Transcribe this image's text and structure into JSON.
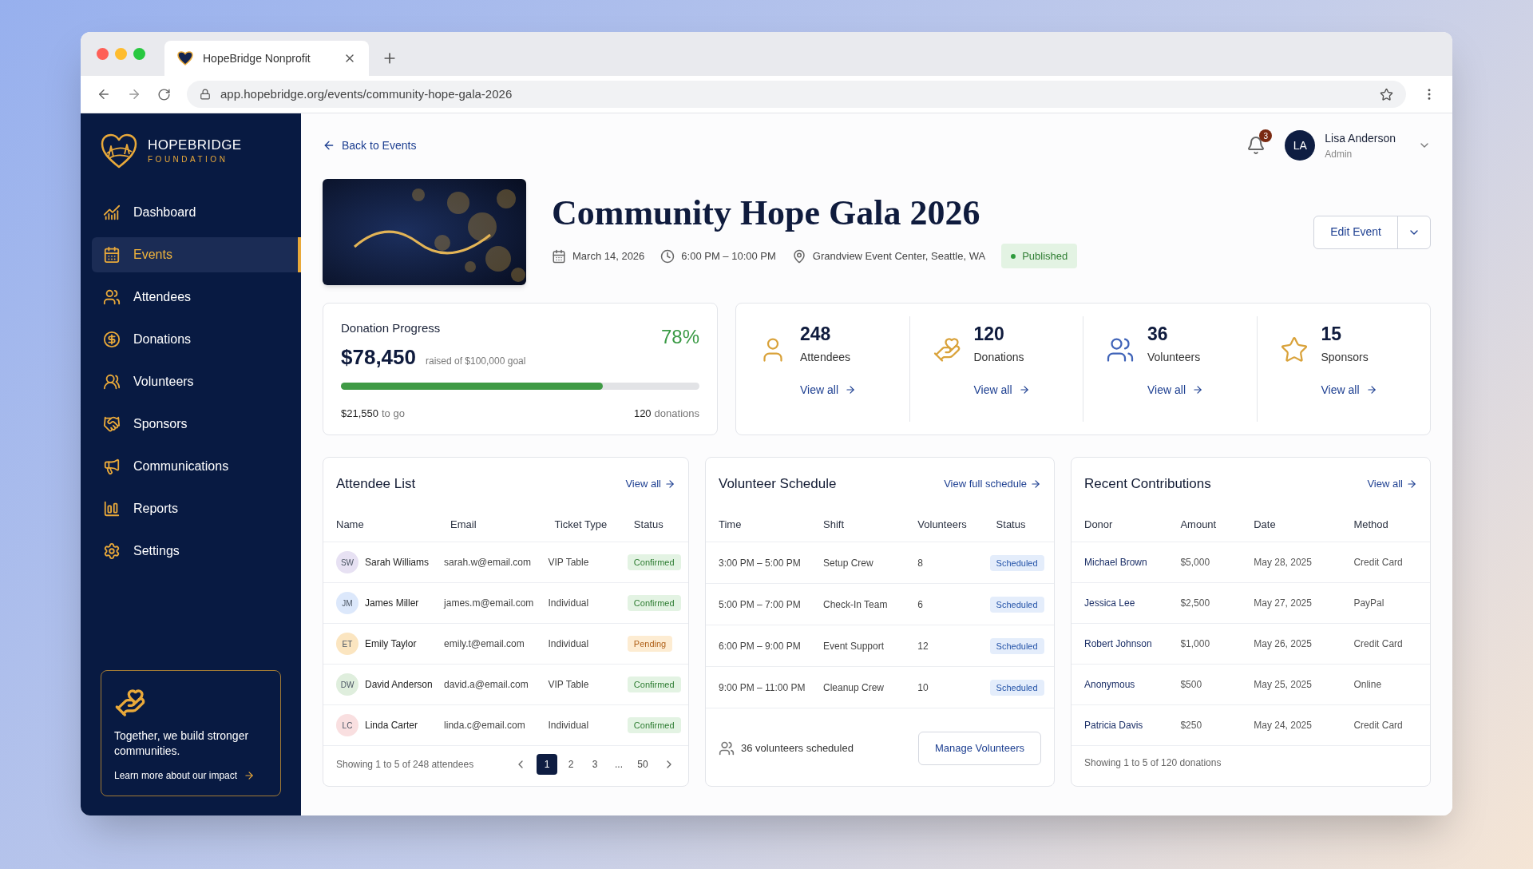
{
  "browser": {
    "tab_title": "HopeBridge Nonprofit",
    "url": "app.hopebridge.org/events/community-hope-gala-2026"
  },
  "sidebar": {
    "brand": {
      "name": "HOPEBRIDGE",
      "tagline": "FOUNDATION"
    },
    "items": [
      {
        "label": "Dashboard",
        "kind": "dashboard",
        "selected": false
      },
      {
        "label": "Events",
        "kind": "events",
        "selected": true
      },
      {
        "label": "Attendees",
        "kind": "attendees",
        "selected": false
      },
      {
        "label": "Donations",
        "kind": "donations",
        "selected": false
      },
      {
        "label": "Volunteers",
        "kind": "volunteers",
        "selected": false
      },
      {
        "label": "Sponsors",
        "kind": "sponsors",
        "selected": false
      },
      {
        "label": "Communications",
        "kind": "communications",
        "selected": false
      },
      {
        "label": "Reports",
        "kind": "reports",
        "selected": false
      },
      {
        "label": "Settings",
        "kind": "settings",
        "selected": false
      }
    ],
    "promo": {
      "text": "Together, we build stronger communities.",
      "link": "Learn more about our impact"
    }
  },
  "header": {
    "back_link": "Back to Events",
    "notifications": "3",
    "user": {
      "initials": "LA",
      "name": "Lisa Anderson",
      "role": "Admin"
    }
  },
  "event": {
    "title": "Community Hope Gala 2026",
    "date": "March 14, 2026",
    "time": "6:00 PM – 10:00 PM",
    "location": "Grandview Event Center, Seattle, WA",
    "status": "Published",
    "edit_button": "Edit Event"
  },
  "donation_progress": {
    "title": "Donation Progress",
    "amount": "$78,450",
    "goal": "raised of $100,000 goal",
    "percent": "78%",
    "level": 0.73,
    "remaining": "$21,550",
    "remaining_suffix": "to go",
    "count": "120",
    "count_suffix": "donations"
  },
  "stats": [
    {
      "kind": "attendees",
      "value": "248",
      "label": "Attendees",
      "link": "View all"
    },
    {
      "kind": "donations",
      "value": "120",
      "label": "Donations",
      "link": "View all"
    },
    {
      "kind": "volunteers",
      "value": "36",
      "label": "Volunteers",
      "link": "View all"
    },
    {
      "kind": "sponsors",
      "value": "15",
      "label": "Sponsors",
      "link": "View all"
    }
  ],
  "attendee_list": {
    "title": "Attendee List",
    "link": "View all",
    "columns": [
      "Name",
      "Email",
      "Ticket Type",
      "Status"
    ],
    "rows": [
      {
        "initials": "SW",
        "color": "#e7e1f3",
        "name": "Sarah Williams",
        "email": "sarah.w@email.com",
        "ticket": "VIP Table",
        "status": "Confirmed",
        "kind": "confirmed"
      },
      {
        "initials": "JM",
        "color": "#dce8fb",
        "name": "James Miller",
        "email": "james.m@email.com",
        "ticket": "Individual",
        "status": "Confirmed",
        "kind": "confirmed"
      },
      {
        "initials": "ET",
        "color": "#fbe5c0",
        "name": "Emily Taylor",
        "email": "emily.t@email.com",
        "ticket": "Individual",
        "status": "Pending",
        "kind": "pending"
      },
      {
        "initials": "DW",
        "color": "#dfeedd",
        "name": "David Anderson",
        "email": "david.a@email.com",
        "ticket": "VIP Table",
        "status": "Confirmed",
        "kind": "confirmed"
      },
      {
        "initials": "LC",
        "color": "#f9dfe0",
        "name": "Linda Carter",
        "email": "linda.c@email.com",
        "ticket": "Individual",
        "status": "Confirmed",
        "kind": "confirmed"
      }
    ],
    "footer": "Showing 1 to 5 of 248 attendees",
    "pages": [
      {
        "label": "1",
        "selected": true
      },
      {
        "label": "2",
        "selected": false
      },
      {
        "label": "3",
        "selected": false
      },
      {
        "label": "...",
        "selected": false
      },
      {
        "label": "50",
        "selected": false
      }
    ]
  },
  "volunteer_schedule": {
    "title": "Volunteer Schedule",
    "link": "View full schedule",
    "columns": [
      "Time",
      "Shift",
      "Volunteers",
      "Status"
    ],
    "rows": [
      {
        "time": "3:00 PM – 5:00 PM",
        "shift": "Setup Crew",
        "volunteers": "8",
        "status": "Scheduled"
      },
      {
        "time": "5:00 PM – 7:00 PM",
        "shift": "Check-In Team",
        "volunteers": "6",
        "status": "Scheduled"
      },
      {
        "time": "6:00 PM – 9:00 PM",
        "shift": "Event Support",
        "volunteers": "12",
        "status": "Scheduled"
      },
      {
        "time": "9:00 PM – 11:00 PM",
        "shift": "Cleanup Crew",
        "volunteers": "10",
        "status": "Scheduled"
      }
    ],
    "summary": "36 volunteers scheduled",
    "button": "Manage Volunteers"
  },
  "recent_contributions": {
    "title": "Recent Contributions",
    "link": "View all",
    "columns": [
      "Donor",
      "Amount",
      "Date",
      "Method"
    ],
    "rows": [
      {
        "donor": "Michael Brown",
        "amount": "$5,000",
        "date": "May 28, 2025",
        "method": "Credit Card"
      },
      {
        "donor": "Jessica Lee",
        "amount": "$2,500",
        "date": "May 27, 2025",
        "method": "PayPal"
      },
      {
        "donor": "Robert Johnson",
        "amount": "$1,000",
        "date": "May 26, 2025",
        "method": "Credit Card"
      },
      {
        "donor": "Anonymous",
        "amount": "$500",
        "date": "May 25, 2025",
        "method": "Online"
      },
      {
        "donor": "Patricia Davis",
        "amount": "$250",
        "date": "May 24, 2025",
        "method": "Credit Card"
      }
    ],
    "footer": "Showing 1 to 5 of 120 donations"
  }
}
